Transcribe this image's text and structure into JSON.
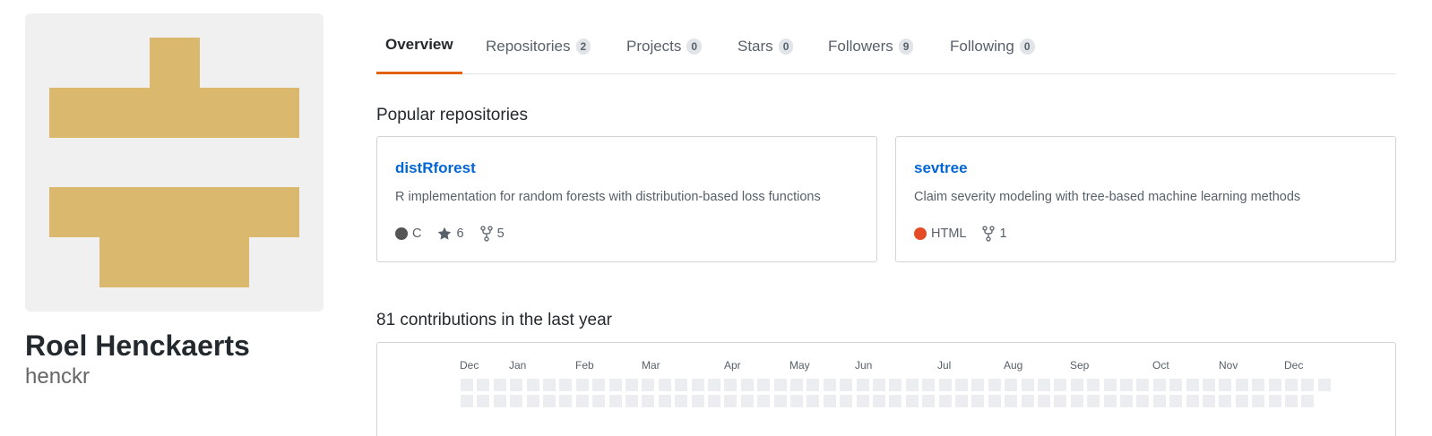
{
  "profile": {
    "name": "Roel Henckaerts",
    "login": "henckr",
    "avatar_color": "#dab86d",
    "avatar_bg": "#f0f0f0"
  },
  "tabs": [
    {
      "label": "Overview",
      "count": null,
      "selected": true
    },
    {
      "label": "Repositories",
      "count": "2",
      "selected": false
    },
    {
      "label": "Projects",
      "count": "0",
      "selected": false
    },
    {
      "label": "Stars",
      "count": "0",
      "selected": false
    },
    {
      "label": "Followers",
      "count": "9",
      "selected": false
    },
    {
      "label": "Following",
      "count": "0",
      "selected": false
    }
  ],
  "popular": {
    "title": "Popular repositories",
    "repos": [
      {
        "name": "distRforest",
        "description": "R implementation for random forests with distribution-based loss functions",
        "language": "C",
        "language_color": "#555555",
        "stars": "6",
        "forks": "5"
      },
      {
        "name": "sevtree",
        "description": "Claim severity modeling with tree-based machine learning methods",
        "language": "HTML",
        "language_color": "#e34c26",
        "forks": "1"
      }
    ]
  },
  "contributions": {
    "title": "81 contributions in the last year",
    "months": [
      "Dec",
      "Jan",
      "Feb",
      "Mar",
      "Apr",
      "May",
      "Jun",
      "Jul",
      "Aug",
      "Sep",
      "Oct",
      "Nov",
      "Dec"
    ],
    "empty_color": "#ebedf0"
  },
  "colors": {
    "accent_tab": "#e36209",
    "link": "#0366d6"
  }
}
